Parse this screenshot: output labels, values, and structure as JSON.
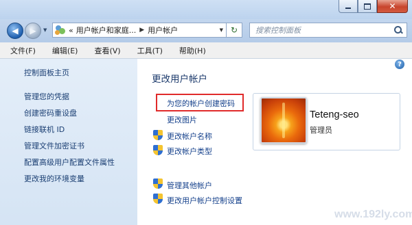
{
  "address": {
    "crumb1": "用户帐户和家庭...",
    "crumb2": "用户帐户"
  },
  "search": {
    "placeholder": "搜索控制面板"
  },
  "menu": [
    "文件(F)",
    "编辑(E)",
    "查看(V)",
    "工具(T)",
    "帮助(H)"
  ],
  "sidebar": {
    "home": "控制面板主页",
    "items": [
      "管理您的凭据",
      "创建密码重设盘",
      "链接联机 ID",
      "管理文件加密证书",
      "配置高级用户配置文件属性",
      "更改我的环境变量"
    ]
  },
  "main": {
    "title": "更改用户帐户",
    "tasks": [
      "为您的帐户创建密码",
      "更改图片",
      "更改帐户名称",
      "更改帐户类型"
    ],
    "other_tasks": [
      "管理其他帐户",
      "更改用户帐户控制设置"
    ]
  },
  "user": {
    "name": "Teteng-seo",
    "role": "管理员"
  },
  "watermark": "www.192ly.com",
  "colors": {
    "highlight_border": "#e02a2a",
    "link": "#14408b",
    "close_button": "#c8452d"
  }
}
